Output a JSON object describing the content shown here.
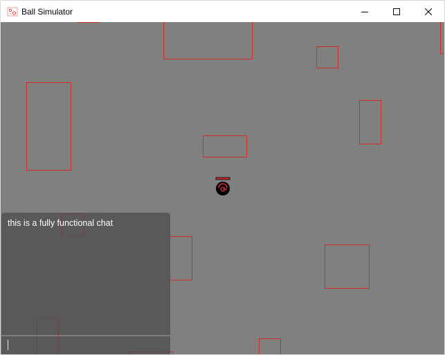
{
  "window": {
    "title": "Ball Simulator",
    "icon": "ball-simulator-app-icon",
    "controls": [
      "minimize-icon",
      "maximize-icon",
      "close-icon"
    ]
  },
  "game": {
    "background_color": "#808080",
    "obstacle_color": "#d42a2a",
    "player_color": "#000000",
    "player_accent": "#d42a2a"
  },
  "chat": {
    "messages": [
      "this is a fully functional chat"
    ],
    "input_value": ""
  }
}
